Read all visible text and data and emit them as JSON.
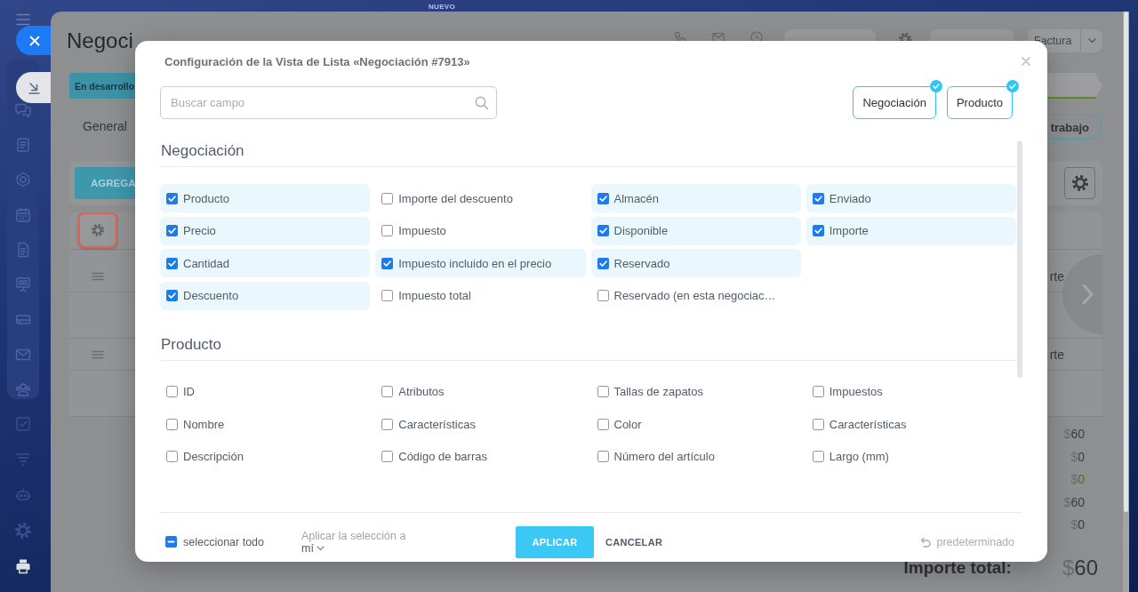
{
  "top_bar": {
    "badge": "NUEVO"
  },
  "page": {
    "title": "Negoci",
    "toolbar": {
      "invoice": "Factura"
    },
    "stage": "En desarrollo",
    "tabs": [
      {
        "label": "General",
        "selected": false
      }
    ],
    "work_button": "trabajo",
    "add_button": "AGREGA",
    "product_rows": [
      {
        "column_label": "rte"
      },
      {
        "column_label": "rte"
      }
    ],
    "totals": [
      {
        "value": "$60",
        "color": "#3b3c40"
      },
      {
        "value": "$0",
        "color": "#3b3c40"
      },
      {
        "value": "$0",
        "color": "#5b6a1c"
      },
      {
        "value": "$60",
        "color": "#3b3c40"
      },
      {
        "value": "$0",
        "color": "#3b3c40"
      }
    ],
    "grand_total": {
      "label": "Importe total:",
      "value": "$60"
    }
  },
  "dialog": {
    "title": "Configuración de la Vista de Lista «Negociación #7913»",
    "search": {
      "placeholder": "Buscar campo"
    },
    "filters": [
      {
        "label": "Negociación",
        "selected": true
      },
      {
        "label": "Producto",
        "selected": true
      }
    ],
    "sections": [
      {
        "title": "Negociación",
        "fields": [
          {
            "label": "Producto",
            "checked": true
          },
          {
            "label": "Precio",
            "checked": true
          },
          {
            "label": "Cantidad",
            "checked": true
          },
          {
            "label": "Descuento",
            "checked": true
          },
          {
            "label": "Importe del descuento",
            "checked": false
          },
          {
            "label": "Impuesto",
            "checked": false
          },
          {
            "label": "Impuesto incluido en el precio",
            "checked": true
          },
          {
            "label": "Impuesto total",
            "checked": false
          },
          {
            "label": "Almacén",
            "checked": true
          },
          {
            "label": "Disponible",
            "checked": true
          },
          {
            "label": "Reservado",
            "checked": true
          },
          {
            "label": "Reservado (en esta negociac…",
            "checked": false
          },
          {
            "label": "Enviado",
            "checked": true
          },
          {
            "label": "Importe",
            "checked": true
          }
        ]
      },
      {
        "title": "Producto",
        "fields": [
          {
            "label": "ID",
            "checked": false
          },
          {
            "label": "Nombre",
            "checked": false
          },
          {
            "label": "Descripción",
            "checked": false
          },
          {
            "label": "Atributos",
            "checked": false
          },
          {
            "label": "Características",
            "checked": false
          },
          {
            "label": "Código de barras",
            "checked": false
          },
          {
            "label": "Tallas de zapatos",
            "checked": false
          },
          {
            "label": "Color",
            "checked": false
          },
          {
            "label": "Número del artículo",
            "checked": false
          },
          {
            "label": "Impuestos",
            "checked": false
          },
          {
            "label": "Características",
            "checked": false
          },
          {
            "label": "Largo (mm)",
            "checked": false
          }
        ]
      }
    ],
    "footer": {
      "select_all": {
        "label": "seleccionar todo",
        "indeterminate": true
      },
      "apply_to": {
        "label": "Aplicar la selección a",
        "value": "mí"
      },
      "buttons": [
        {
          "label": "APLICAR",
          "kind": "primary"
        },
        {
          "label": "CANCELAR",
          "kind": "link"
        }
      ],
      "reset": {
        "label": "predeterminado"
      }
    }
  }
}
